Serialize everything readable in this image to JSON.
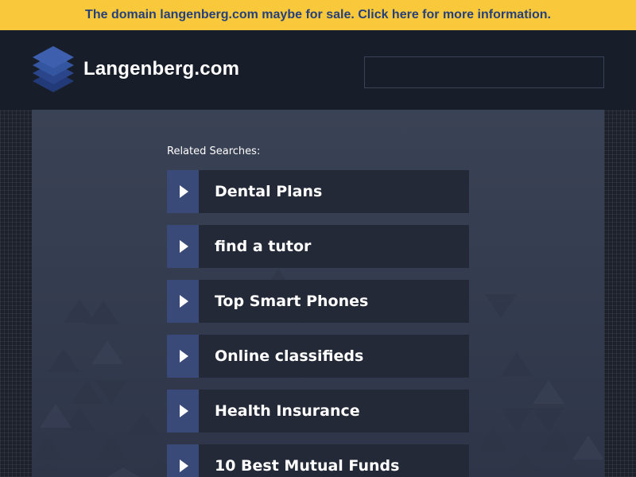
{
  "banner": {
    "text": "The domain langenberg.com maybe for sale. Click here for more information."
  },
  "header": {
    "site_name": "Langenberg.com",
    "logo_icon": "stacked-layers-icon",
    "search": {
      "value": "",
      "placeholder": ""
    }
  },
  "related": {
    "label": "Related Searches:",
    "arrow_icon": "play-arrow-icon",
    "items": [
      {
        "label": "Dental Plans"
      },
      {
        "label": "find a tutor"
      },
      {
        "label": "Top Smart Phones"
      },
      {
        "label": "Online classifieds"
      },
      {
        "label": "Health Insurance"
      },
      {
        "label": "10 Best Mutual Funds"
      }
    ]
  },
  "colors": {
    "banner_bg": "#f9c93b",
    "banner_text": "#27407a",
    "header_bg": "#181e29",
    "content_bg": "#3a4255",
    "link_bg": "#232936",
    "arrow_bg": "#3a4a78",
    "logo_blue": "#2e4a8f"
  }
}
